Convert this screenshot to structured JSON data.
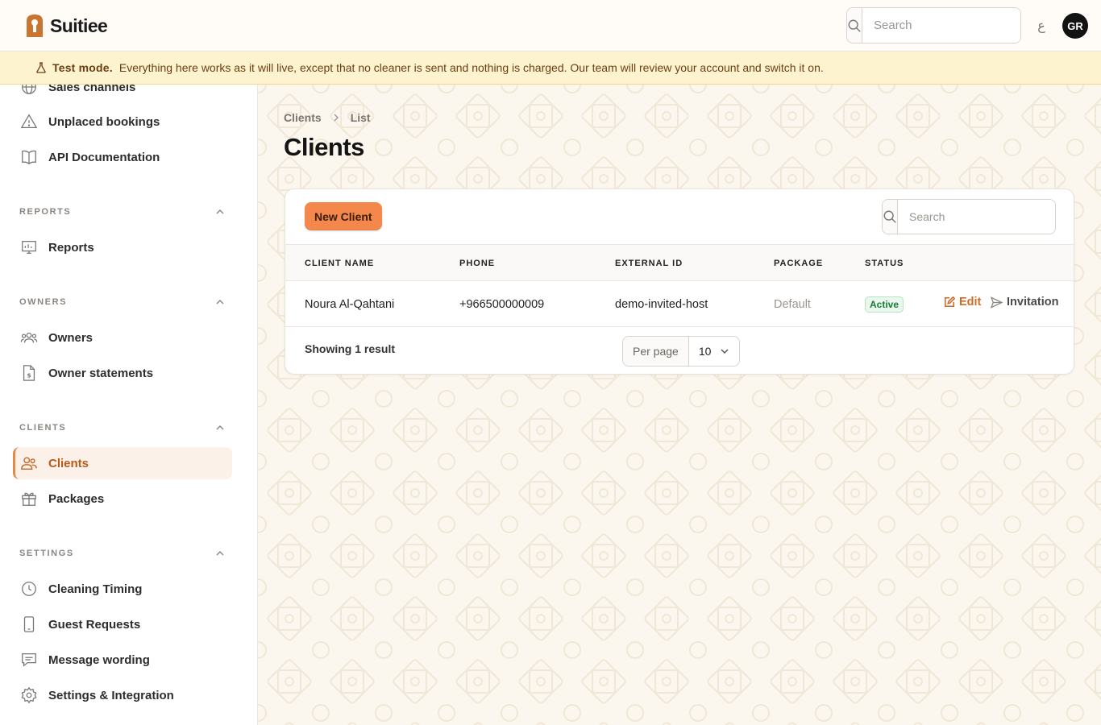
{
  "app": {
    "name": "Suitiee"
  },
  "topbar": {
    "search_placeholder": "Search",
    "lang_label": "ع",
    "avatar_initials": "GR"
  },
  "banner": {
    "title": "Test mode.",
    "message": "Everything here works as it will live, except that no cleaner is sent and nothing is charged. Our team will review your account and switch it on."
  },
  "sidebar": {
    "items_top": [
      {
        "label": "Sales channels",
        "icon": "globe-icon"
      },
      {
        "label": "Unplaced bookings",
        "icon": "warning-icon"
      },
      {
        "label": "API Documentation",
        "icon": "book-icon"
      }
    ],
    "groups": [
      {
        "label": "REPORTS",
        "items": [
          {
            "label": "Reports",
            "icon": "chart-icon"
          }
        ]
      },
      {
        "label": "OWNERS",
        "items": [
          {
            "label": "Owners",
            "icon": "users-icon"
          },
          {
            "label": "Owner statements",
            "icon": "document-dollar-icon"
          }
        ]
      },
      {
        "label": "CLIENTS",
        "items": [
          {
            "label": "Clients",
            "icon": "user-group-icon",
            "active": true
          },
          {
            "label": "Packages",
            "icon": "gift-icon"
          }
        ]
      },
      {
        "label": "SETTINGS",
        "items": [
          {
            "label": "Cleaning Timing",
            "icon": "clock-icon"
          },
          {
            "label": "Guest Requests",
            "icon": "phone-icon"
          },
          {
            "label": "Message wording",
            "icon": "chat-icon"
          },
          {
            "label": "Settings & Integration",
            "icon": "cog-icon"
          }
        ]
      }
    ]
  },
  "main": {
    "breadcrumb": [
      "Clients",
      "List"
    ],
    "title": "Clients",
    "new_button": "New Client",
    "search_placeholder": "Search",
    "table": {
      "columns": [
        "CLIENT NAME",
        "PHONE",
        "EXTERNAL ID",
        "PACKAGE",
        "STATUS"
      ],
      "rows": [
        {
          "name": "Noura Al-Qahtani",
          "phone": "+966500000009",
          "external_id": "demo-invited-host",
          "package": "Default",
          "status": "Active"
        }
      ],
      "actions": {
        "edit": "Edit",
        "invitation": "Invitation"
      }
    },
    "footer": {
      "showing": "Showing 1 result",
      "per_page_label": "Per page",
      "per_page_value": "10"
    }
  },
  "colors": {
    "accent": "#f4884c",
    "accent_text": "#d26a23",
    "banner_bg": "#fdf3cf",
    "active_badge": "#1b7a3a"
  }
}
